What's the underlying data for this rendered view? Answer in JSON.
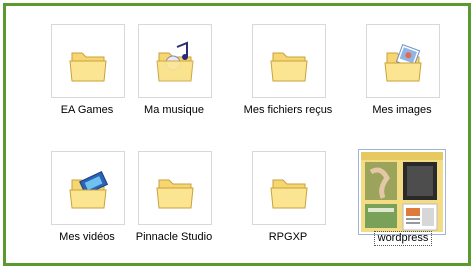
{
  "folders": [
    {
      "label": "EA Games",
      "icon": "folder-icon"
    },
    {
      "label": "Ma musique",
      "icon": "music-folder-icon"
    },
    {
      "label": "Mes fichiers reçus",
      "icon": "folder-icon"
    },
    {
      "label": "Mes images",
      "icon": "pictures-folder-icon"
    },
    {
      "label": "Mes vidéos",
      "icon": "videos-folder-icon"
    },
    {
      "label": "Pinnacle Studio",
      "icon": "folder-icon"
    },
    {
      "label": "RPGXP",
      "icon": "folder-icon"
    },
    {
      "label": "wordpress",
      "icon": "thumbnail-preview-icon"
    }
  ],
  "colors": {
    "frame_border": "#5a9a2e",
    "folder_fill": "#f7dc7a",
    "folder_shadow": "#d9b441"
  }
}
